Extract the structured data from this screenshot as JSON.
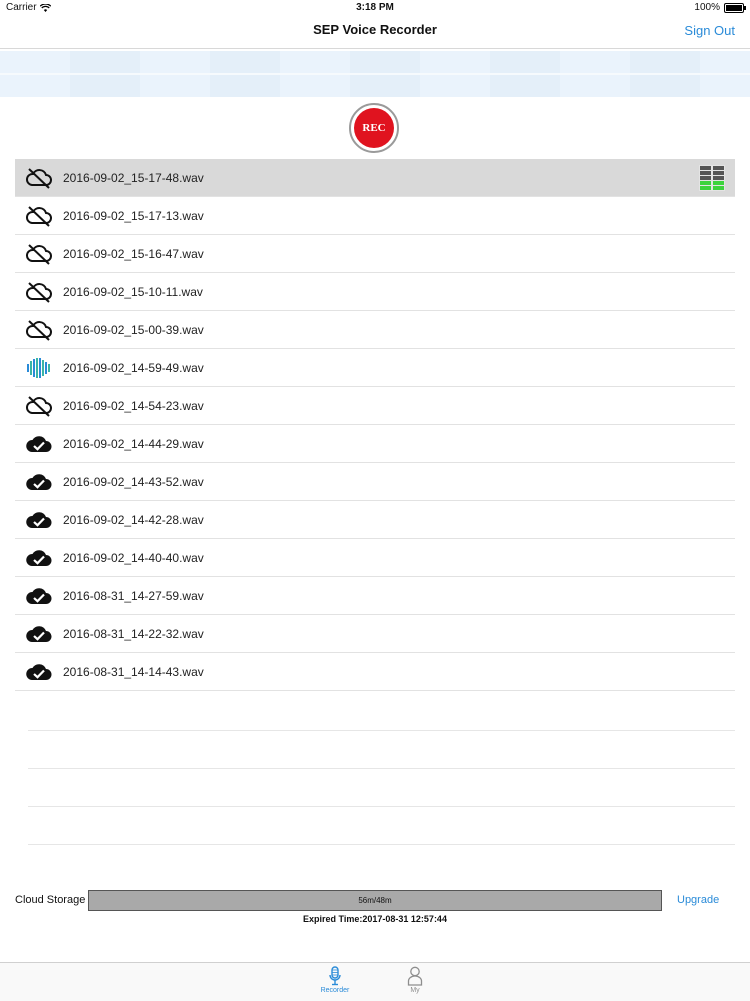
{
  "status": {
    "carrier": "Carrier",
    "time": "3:18 PM",
    "battery": "100%"
  },
  "nav": {
    "title": "SEP Voice Recorder",
    "sign_out": "Sign Out"
  },
  "rec_button": {
    "label": "REC"
  },
  "recordings": [
    {
      "name": "2016-09-02_15-17-48.wav",
      "status": "cloud-off-icon",
      "selected": true
    },
    {
      "name": "2016-09-02_15-17-13.wav",
      "status": "cloud-off-icon"
    },
    {
      "name": "2016-09-02_15-16-47.wav",
      "status": "cloud-off-icon"
    },
    {
      "name": "2016-09-02_15-10-11.wav",
      "status": "cloud-off-icon"
    },
    {
      "name": "2016-09-02_15-00-39.wav",
      "status": "cloud-off-icon"
    },
    {
      "name": "2016-09-02_14-59-49.wav",
      "status": "waveform-icon"
    },
    {
      "name": "2016-09-02_14-54-23.wav",
      "status": "cloud-off-icon"
    },
    {
      "name": "2016-09-02_14-44-29.wav",
      "status": "cloud-check-icon"
    },
    {
      "name": "2016-09-02_14-43-52.wav",
      "status": "cloud-check-icon"
    },
    {
      "name": "2016-09-02_14-42-28.wav",
      "status": "cloud-check-icon"
    },
    {
      "name": "2016-09-02_14-40-40.wav",
      "status": "cloud-check-icon"
    },
    {
      "name": "2016-08-31_14-27-59.wav",
      "status": "cloud-check-icon"
    },
    {
      "name": "2016-08-31_14-22-32.wav",
      "status": "cloud-check-icon"
    },
    {
      "name": "2016-08-31_14-14-43.wav",
      "status": "cloud-check-icon"
    }
  ],
  "storage": {
    "label": "Cloud Storage",
    "usage": "56m/48m",
    "upgrade": "Upgrade",
    "expired": "Expired Time:2017-08-31 12:57:44"
  },
  "tabs": {
    "recorder": "Recorder",
    "my": "My"
  },
  "colors": {
    "accent": "#2a8bd8",
    "rec": "#e0131f"
  }
}
